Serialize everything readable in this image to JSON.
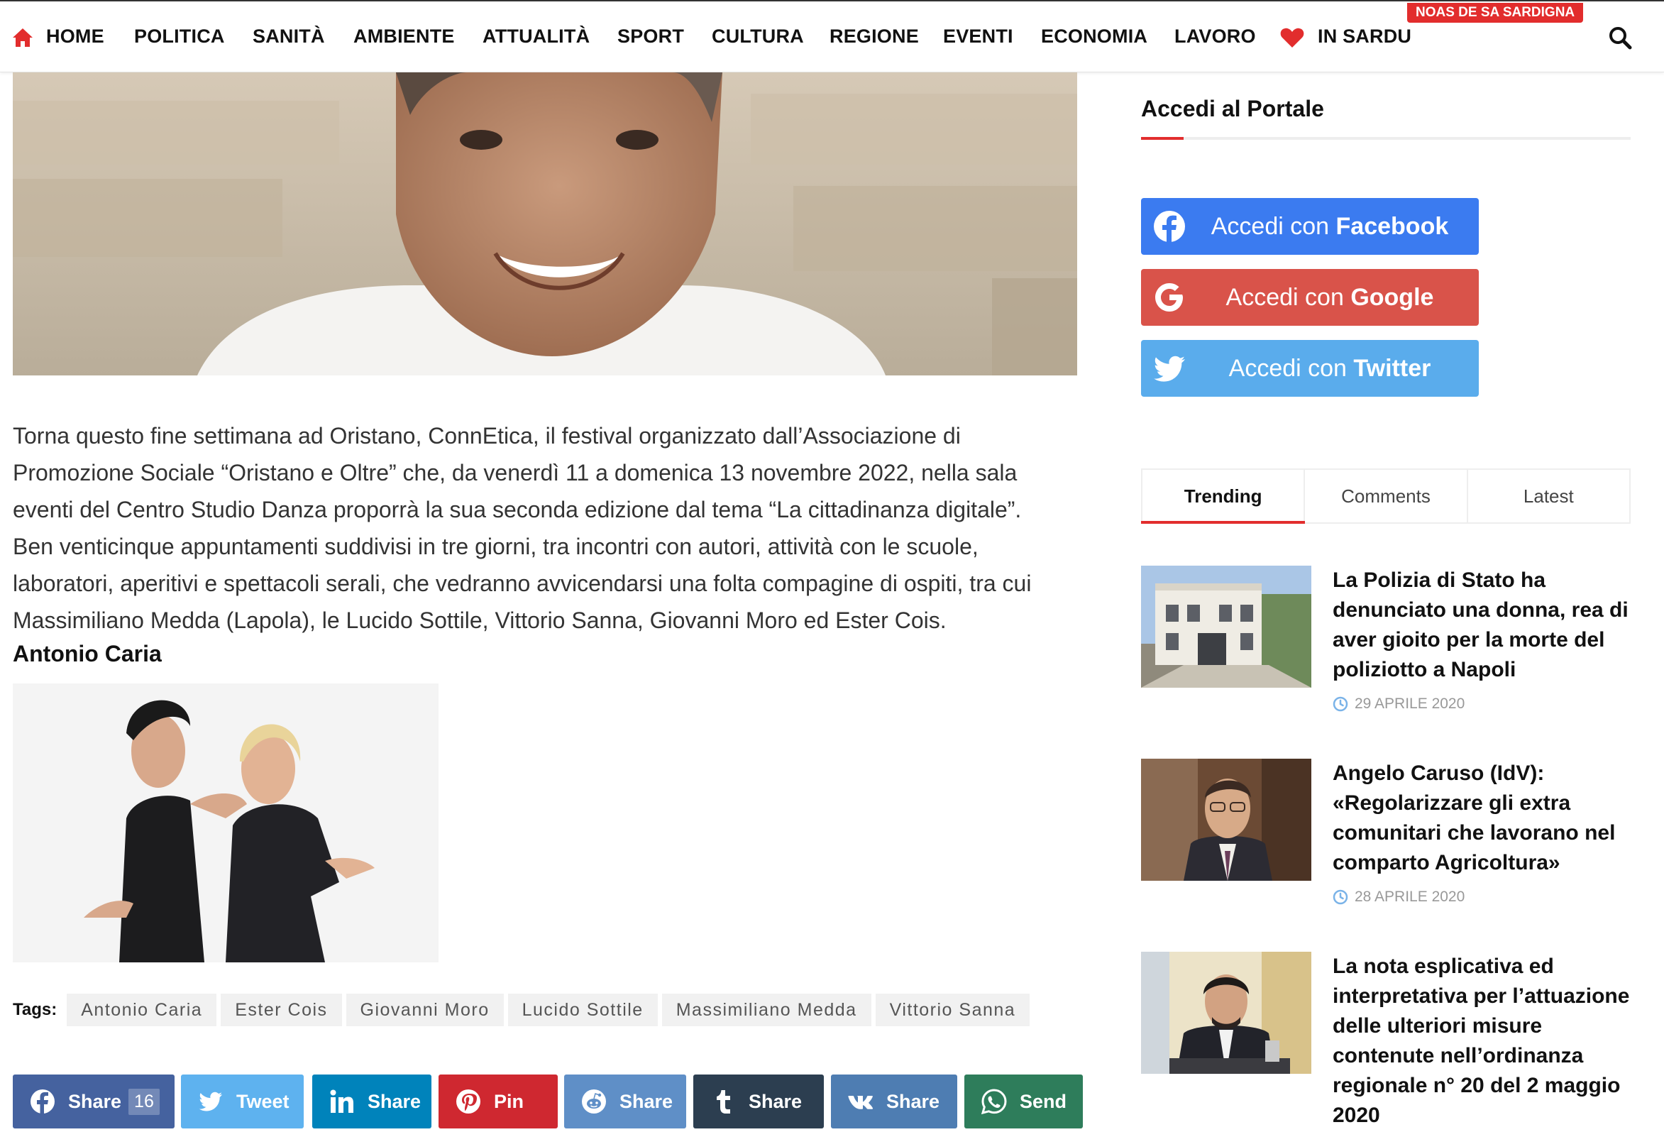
{
  "nav": {
    "items": [
      "HOME",
      "POLITICA",
      "SANITÀ",
      "AMBIENTE",
      "ATTUALITÀ",
      "SPORT",
      "CULTURA",
      "REGIONE",
      "EVENTI",
      "ECONOMIA",
      "LAVORO",
      "IN SARDU"
    ],
    "badge": "NOAS DE SA SARDIGNA",
    "accent_color": "#e22d2d"
  },
  "article": {
    "paragraph1": "Torna questo fine settimana ad Oristano, ConnEtica, il festival organizzato dall’Associazione di Promozione Sociale “Oristano e Oltre” che, da venerdì 11 a domenica 13 novembre 2022, nella sala eventi del Centro Studio Danza proporrà la sua seconda edizione dal tema “La cittadinanza digitale”.",
    "paragraph2": "Ben venticinque appuntamenti suddivisi in tre giorni, tra incontri con autori, attività con le scuole, laboratori, aperitivi e spettacoli serali, che vedranno avvicendarsi una folta compagine di ospiti, tra cui Massimiliano Medda (Lapola), le Lucido Sottile, Vittorio Sanna, Giovanni Moro ed Ester Cois.",
    "author": "Antonio Caria"
  },
  "tags": {
    "label": "Tags:",
    "items": [
      "Antonio Caria",
      "Ester Cois",
      "Giovanni Moro",
      "Lucido Sottile",
      "Massimiliano Medda",
      "Vittorio Sanna"
    ]
  },
  "share": {
    "facebook": {
      "label": "Share",
      "count": "16",
      "color": "#45629f"
    },
    "twitter": {
      "label": "Tweet",
      "color": "#5eb2ef"
    },
    "linkedin": {
      "label": "Share",
      "color": "#0083bb"
    },
    "pinterest": {
      "label": "Pin",
      "color": "#cf2830"
    },
    "reddit": {
      "label": "Share",
      "color": "#5f8fc7"
    },
    "tumblr": {
      "label": "Share",
      "color": "#2c3e50"
    },
    "vk": {
      "label": "Share",
      "color": "#4e7db2"
    },
    "whatsapp": {
      "label": "Send",
      "color": "#2e7d5b"
    }
  },
  "sidebar": {
    "title": "Accedi al Portale",
    "login": {
      "prefix": "Accedi con",
      "facebook": "Facebook",
      "google": "Google",
      "twitter": "Twitter",
      "facebook_color": "#3b7bf0",
      "google_color": "#d9534a",
      "twitter_color": "#5aacec"
    },
    "tabs": [
      "Trending",
      "Comments",
      "Latest"
    ],
    "posts": [
      {
        "title": "La Polizia di Stato ha denunciato una donna, rea di aver gioito per la morte del poliziotto a Napoli",
        "date": "29 APRILE 2020"
      },
      {
        "title": "Angelo Caruso (IdV): «Regolarizzare gli extra comunitari che lavorano nel comparto Agricoltura»",
        "date": "28 APRILE 2020"
      },
      {
        "title": "La nota esplicativa ed interpretativa per l’attuazione delle ulteriori misure contenute nell’ordinanza regionale n° 20 del 2 maggio 2020",
        "date": ""
      }
    ]
  }
}
